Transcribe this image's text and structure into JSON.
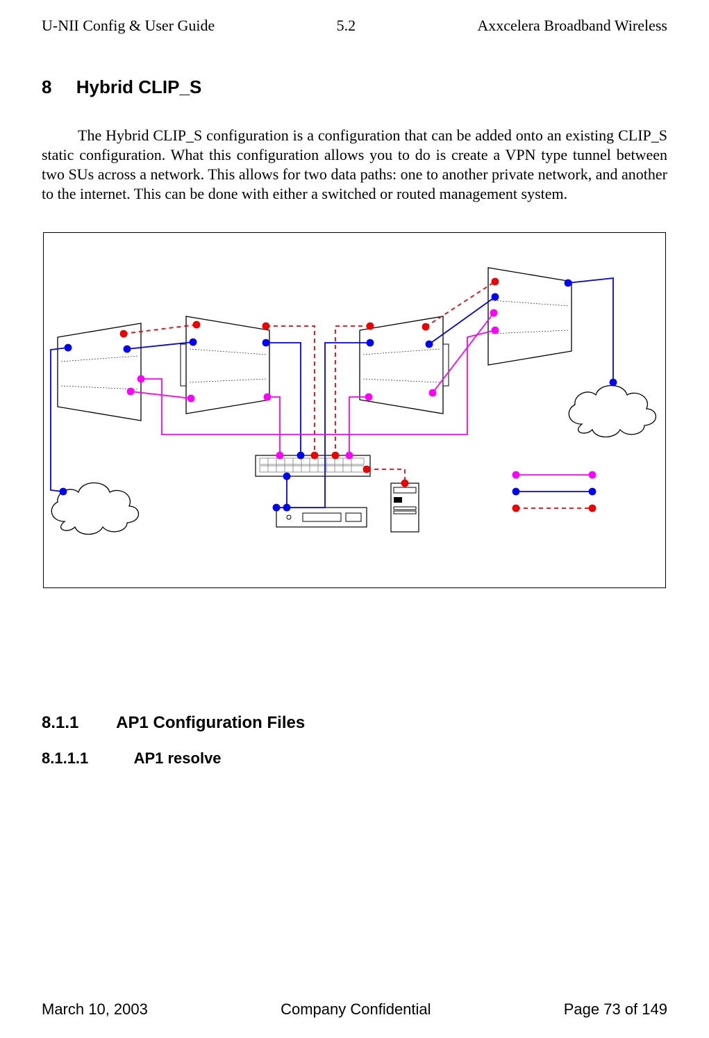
{
  "header": {
    "left": "U-NII Config & User Guide",
    "center": "5.2",
    "right": "Axxcelera Broadband Wireless"
  },
  "section8": {
    "number": "8",
    "title": "Hybrid CLIP_S",
    "paragraph": "The Hybrid CLIP_S configuration is a configuration that can be added onto an existing CLIP_S static configuration. What this configuration allows you to do is create a VPN type tunnel between two SUs across a network. This allows for two data paths: one to another private network, and another to the internet. This can be done with either a switched or routed management system."
  },
  "section811": {
    "number": "8.1.1",
    "title": "AP1 Configuration Files"
  },
  "section8111": {
    "number": "8.1.1.1",
    "title": "AP1 resolve"
  },
  "footer": {
    "left": "March 10, 2003",
    "center": "Company Confidential",
    "right": "Page 73 of 149"
  }
}
